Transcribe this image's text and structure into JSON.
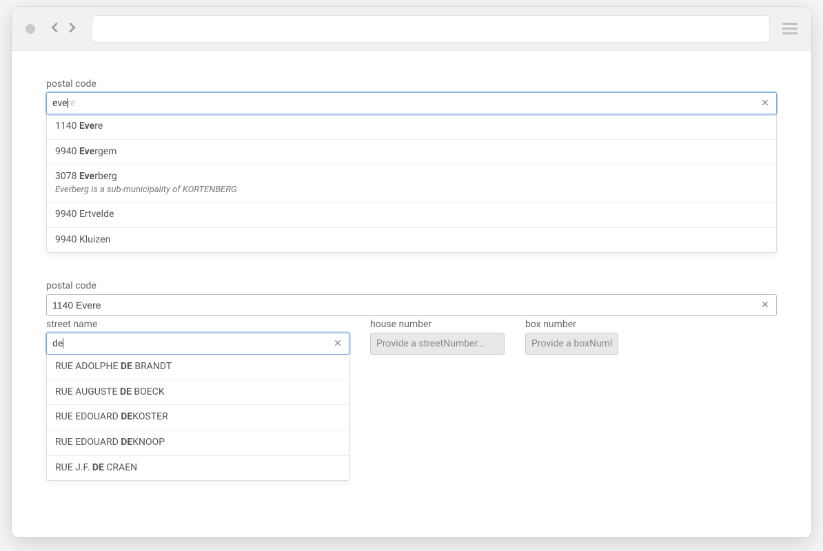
{
  "postal1": {
    "label": "postal code",
    "typed": "eve",
    "hint_rest": "re",
    "suggestions": [
      {
        "code": "1140",
        "prefix": "Eve",
        "suffix": "re",
        "subtitle": ""
      },
      {
        "code": "9940",
        "prefix": "Eve",
        "suffix": "rgem",
        "subtitle": ""
      },
      {
        "code": "3078",
        "prefix": "Eve",
        "suffix": "rberg",
        "subtitle": "Everberg is a sub-municipality of KORTENBERG"
      },
      {
        "code": "9940",
        "prefix": "",
        "suffix": "Ertvelde",
        "subtitle": ""
      },
      {
        "code": "9940",
        "prefix": "",
        "suffix": "Kluizen",
        "subtitle": ""
      }
    ]
  },
  "postal2": {
    "label": "postal code",
    "value": "1140 Evere"
  },
  "street": {
    "label": "street name",
    "typed": "de",
    "suggestions": [
      {
        "pre": "RUE ADOLPHE ",
        "match": "DE",
        "post": " BRANDT"
      },
      {
        "pre": "RUE AUGUSTE ",
        "match": "DE",
        "post": " BOECK"
      },
      {
        "pre": "RUE EDOUARD ",
        "match": "DE",
        "post": "KOSTER"
      },
      {
        "pre": "RUE EDOUARD ",
        "match": "DE",
        "post": "KNOOP"
      },
      {
        "pre": "RUE J.F. ",
        "match": "DE",
        "post": " CRAEN"
      }
    ]
  },
  "house": {
    "label": "house number",
    "placeholder": "Provide a streetNumber..."
  },
  "box": {
    "label": "box number",
    "placeholder": "Provide a boxNuml"
  }
}
